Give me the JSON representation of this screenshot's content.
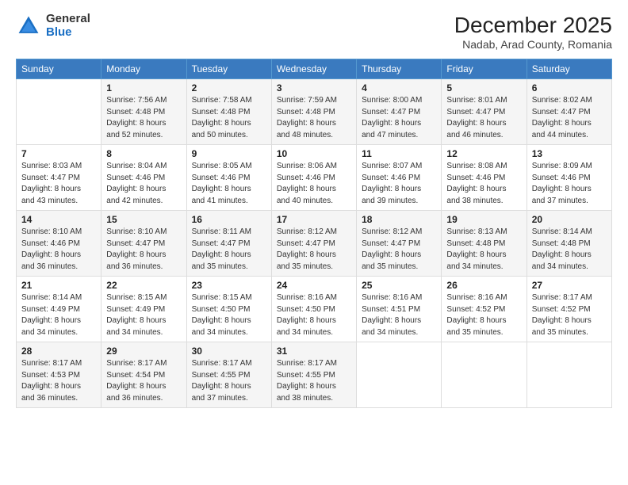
{
  "header": {
    "logo_general": "General",
    "logo_blue": "Blue",
    "main_title": "December 2025",
    "subtitle": "Nadab, Arad County, Romania"
  },
  "calendar": {
    "weekdays": [
      "Sunday",
      "Monday",
      "Tuesday",
      "Wednesday",
      "Thursday",
      "Friday",
      "Saturday"
    ],
    "weeks": [
      [
        {
          "day": "",
          "sunrise": "",
          "sunset": "",
          "daylight": ""
        },
        {
          "day": "1",
          "sunrise": "Sunrise: 7:56 AM",
          "sunset": "Sunset: 4:48 PM",
          "daylight": "Daylight: 8 hours and 52 minutes."
        },
        {
          "day": "2",
          "sunrise": "Sunrise: 7:58 AM",
          "sunset": "Sunset: 4:48 PM",
          "daylight": "Daylight: 8 hours and 50 minutes."
        },
        {
          "day": "3",
          "sunrise": "Sunrise: 7:59 AM",
          "sunset": "Sunset: 4:48 PM",
          "daylight": "Daylight: 8 hours and 48 minutes."
        },
        {
          "day": "4",
          "sunrise": "Sunrise: 8:00 AM",
          "sunset": "Sunset: 4:47 PM",
          "daylight": "Daylight: 8 hours and 47 minutes."
        },
        {
          "day": "5",
          "sunrise": "Sunrise: 8:01 AM",
          "sunset": "Sunset: 4:47 PM",
          "daylight": "Daylight: 8 hours and 46 minutes."
        },
        {
          "day": "6",
          "sunrise": "Sunrise: 8:02 AM",
          "sunset": "Sunset: 4:47 PM",
          "daylight": "Daylight: 8 hours and 44 minutes."
        }
      ],
      [
        {
          "day": "7",
          "sunrise": "Sunrise: 8:03 AM",
          "sunset": "Sunset: 4:47 PM",
          "daylight": "Daylight: 8 hours and 43 minutes."
        },
        {
          "day": "8",
          "sunrise": "Sunrise: 8:04 AM",
          "sunset": "Sunset: 4:46 PM",
          "daylight": "Daylight: 8 hours and 42 minutes."
        },
        {
          "day": "9",
          "sunrise": "Sunrise: 8:05 AM",
          "sunset": "Sunset: 4:46 PM",
          "daylight": "Daylight: 8 hours and 41 minutes."
        },
        {
          "day": "10",
          "sunrise": "Sunrise: 8:06 AM",
          "sunset": "Sunset: 4:46 PM",
          "daylight": "Daylight: 8 hours and 40 minutes."
        },
        {
          "day": "11",
          "sunrise": "Sunrise: 8:07 AM",
          "sunset": "Sunset: 4:46 PM",
          "daylight": "Daylight: 8 hours and 39 minutes."
        },
        {
          "day": "12",
          "sunrise": "Sunrise: 8:08 AM",
          "sunset": "Sunset: 4:46 PM",
          "daylight": "Daylight: 8 hours and 38 minutes."
        },
        {
          "day": "13",
          "sunrise": "Sunrise: 8:09 AM",
          "sunset": "Sunset: 4:46 PM",
          "daylight": "Daylight: 8 hours and 37 minutes."
        }
      ],
      [
        {
          "day": "14",
          "sunrise": "Sunrise: 8:10 AM",
          "sunset": "Sunset: 4:46 PM",
          "daylight": "Daylight: 8 hours and 36 minutes."
        },
        {
          "day": "15",
          "sunrise": "Sunrise: 8:10 AM",
          "sunset": "Sunset: 4:47 PM",
          "daylight": "Daylight: 8 hours and 36 minutes."
        },
        {
          "day": "16",
          "sunrise": "Sunrise: 8:11 AM",
          "sunset": "Sunset: 4:47 PM",
          "daylight": "Daylight: 8 hours and 35 minutes."
        },
        {
          "day": "17",
          "sunrise": "Sunrise: 8:12 AM",
          "sunset": "Sunset: 4:47 PM",
          "daylight": "Daylight: 8 hours and 35 minutes."
        },
        {
          "day": "18",
          "sunrise": "Sunrise: 8:12 AM",
          "sunset": "Sunset: 4:47 PM",
          "daylight": "Daylight: 8 hours and 35 minutes."
        },
        {
          "day": "19",
          "sunrise": "Sunrise: 8:13 AM",
          "sunset": "Sunset: 4:48 PM",
          "daylight": "Daylight: 8 hours and 34 minutes."
        },
        {
          "day": "20",
          "sunrise": "Sunrise: 8:14 AM",
          "sunset": "Sunset: 4:48 PM",
          "daylight": "Daylight: 8 hours and 34 minutes."
        }
      ],
      [
        {
          "day": "21",
          "sunrise": "Sunrise: 8:14 AM",
          "sunset": "Sunset: 4:49 PM",
          "daylight": "Daylight: 8 hours and 34 minutes."
        },
        {
          "day": "22",
          "sunrise": "Sunrise: 8:15 AM",
          "sunset": "Sunset: 4:49 PM",
          "daylight": "Daylight: 8 hours and 34 minutes."
        },
        {
          "day": "23",
          "sunrise": "Sunrise: 8:15 AM",
          "sunset": "Sunset: 4:50 PM",
          "daylight": "Daylight: 8 hours and 34 minutes."
        },
        {
          "day": "24",
          "sunrise": "Sunrise: 8:16 AM",
          "sunset": "Sunset: 4:50 PM",
          "daylight": "Daylight: 8 hours and 34 minutes."
        },
        {
          "day": "25",
          "sunrise": "Sunrise: 8:16 AM",
          "sunset": "Sunset: 4:51 PM",
          "daylight": "Daylight: 8 hours and 34 minutes."
        },
        {
          "day": "26",
          "sunrise": "Sunrise: 8:16 AM",
          "sunset": "Sunset: 4:52 PM",
          "daylight": "Daylight: 8 hours and 35 minutes."
        },
        {
          "day": "27",
          "sunrise": "Sunrise: 8:17 AM",
          "sunset": "Sunset: 4:52 PM",
          "daylight": "Daylight: 8 hours and 35 minutes."
        }
      ],
      [
        {
          "day": "28",
          "sunrise": "Sunrise: 8:17 AM",
          "sunset": "Sunset: 4:53 PM",
          "daylight": "Daylight: 8 hours and 36 minutes."
        },
        {
          "day": "29",
          "sunrise": "Sunrise: 8:17 AM",
          "sunset": "Sunset: 4:54 PM",
          "daylight": "Daylight: 8 hours and 36 minutes."
        },
        {
          "day": "30",
          "sunrise": "Sunrise: 8:17 AM",
          "sunset": "Sunset: 4:55 PM",
          "daylight": "Daylight: 8 hours and 37 minutes."
        },
        {
          "day": "31",
          "sunrise": "Sunrise: 8:17 AM",
          "sunset": "Sunset: 4:55 PM",
          "daylight": "Daylight: 8 hours and 38 minutes."
        },
        {
          "day": "",
          "sunrise": "",
          "sunset": "",
          "daylight": ""
        },
        {
          "day": "",
          "sunrise": "",
          "sunset": "",
          "daylight": ""
        },
        {
          "day": "",
          "sunrise": "",
          "sunset": "",
          "daylight": ""
        }
      ]
    ]
  }
}
